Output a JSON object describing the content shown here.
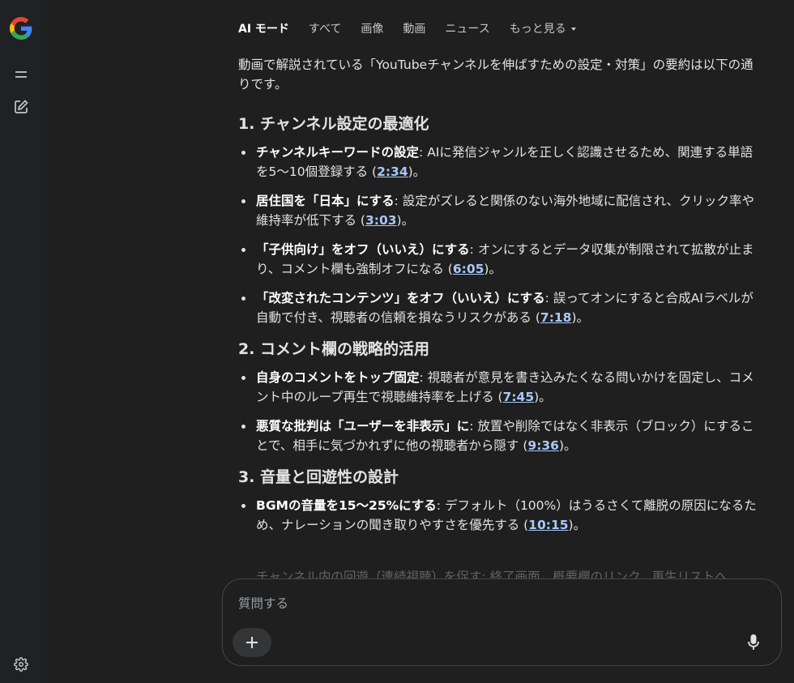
{
  "tabs": [
    {
      "label": "AI モード",
      "active": true
    },
    {
      "label": "すべて"
    },
    {
      "label": "画像"
    },
    {
      "label": "動画"
    },
    {
      "label": "ニュース"
    },
    {
      "label": "もっと見る"
    }
  ],
  "rail": {
    "icons": [
      "google-logo",
      "menu-icon",
      "new-chat-icon",
      "settings-icon"
    ]
  },
  "answer": {
    "intro": "動画で解説されている「YouTubeチャンネルを伸ばすための設定・対策」の要約は以下の通りです。",
    "sections": [
      {
        "heading": "1. チャンネル設定の最適化",
        "items": [
          {
            "bold": "チャンネルキーワードの設定",
            "text": ": AIに発信ジャンルを正しく認識させるため、関連する単語を5〜10個登録する (",
            "link": "2:34",
            "end": ")。"
          },
          {
            "bold": "居住国を「日本」にする",
            "text": ": 設定がズレると関係のない海外地域に配信され、クリック率や維持率が低下する (",
            "link": "3:03",
            "end": ")。"
          },
          {
            "bold": "「子供向け」をオフ（いいえ）にする",
            "text": ": オンにするとデータ収集が制限されて拡散が止まり、コメント欄も強制オフになる (",
            "link": "6:05",
            "end": ")。"
          },
          {
            "bold": "「改変されたコンテンツ」をオフ（いいえ）にする",
            "text": ": 誤ってオンにすると合成AIラベルが自動で付き、視聴者の信頼を損なうリスクがある (",
            "link": "7:18",
            "end": ")。"
          }
        ]
      },
      {
        "heading": "2. コメント欄の戦略的活用",
        "items": [
          {
            "bold": "自身のコメントをトップ固定",
            "text": ": 視聴者が意見を書き込みたくなる問いかけを固定し、コメント中のループ再生で視聴維持率を上げる (",
            "link": "7:45",
            "end": ")。"
          },
          {
            "bold": "悪質な批判は「ユーザーを非表示」に",
            "text": ": 放置や削除ではなく非表示（ブロック）にすることで、相手に気づかれずに他の視聴者から隠す (",
            "link": "9:36",
            "end": ")。"
          }
        ]
      },
      {
        "heading": "3. 音量と回遊性の設計",
        "items": [
          {
            "bold": "BGMの音量を15〜25%にする",
            "text": ": デフォルト（100%）はうるさくて離脱の原因になるため、ナレーションの聞き取りやすさを優先する (",
            "link": "10:15",
            "end": ")。"
          }
        ]
      }
    ],
    "faded_line": "チャンネル内の回遊（連続視聴）を促す: 終了画面、概要欄のリンク、再生リストへ"
  },
  "input": {
    "placeholder": "質問する"
  },
  "colors": {
    "background": "#1f1f1f",
    "rail": "#202124",
    "link": "#a8c7fa",
    "text": "#e3e3e3"
  }
}
